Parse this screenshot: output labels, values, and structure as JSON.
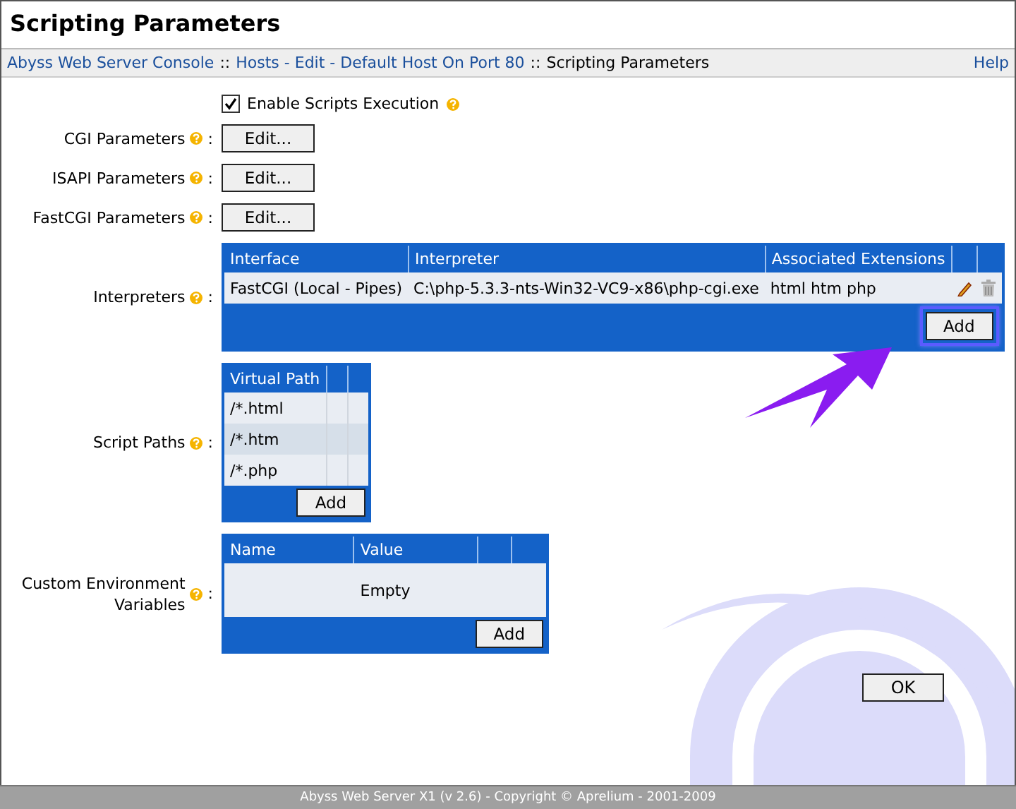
{
  "window": {
    "title": "Scripting Parameters"
  },
  "breadcrumb": {
    "links": [
      "Abyss Web Server Console",
      "Hosts - Edit - Default Host On Port 80"
    ],
    "separator": "::",
    "current": "Scripting Parameters",
    "help": "Help"
  },
  "enable_scripts": {
    "label": "Enable Scripts Execution",
    "checked": true
  },
  "parameters": [
    {
      "label": "CGI Parameters",
      "colon": ":",
      "button": "Edit..."
    },
    {
      "label": "ISAPI Parameters",
      "colon": ":",
      "button": "Edit..."
    },
    {
      "label": "FastCGI Parameters",
      "colon": ":",
      "button": "Edit..."
    }
  ],
  "interpreters": {
    "label": "Interpreters",
    "colon": ":",
    "columns": [
      "Interface",
      "Interpreter",
      "Associated Extensions"
    ],
    "rows": [
      {
        "interface": "FastCGI (Local - Pipes)",
        "interpreter": "C:\\php-5.3.3-nts-Win32-VC9-x86\\php-cgi.exe",
        "extensions": "html htm php"
      }
    ],
    "add_button": "Add",
    "highlighted": true
  },
  "script_paths": {
    "label": "Script Paths",
    "colon": ":",
    "columns": [
      "Virtual Path"
    ],
    "rows": [
      {
        "path": "/*.html",
        "selected": false
      },
      {
        "path": "/*.htm",
        "selected": true
      },
      {
        "path": "/*.php",
        "selected": false
      }
    ],
    "add_button": "Add"
  },
  "env_vars": {
    "label": "Custom Environment Variables",
    "colon": ":",
    "columns": [
      "Name",
      "Value"
    ],
    "empty_text": "Empty",
    "add_button": "Add"
  },
  "ok_button": "OK",
  "status_bar": "Abyss Web Server X1 (v 2.6) - Copyright © Aprelium - 2001-2009"
}
